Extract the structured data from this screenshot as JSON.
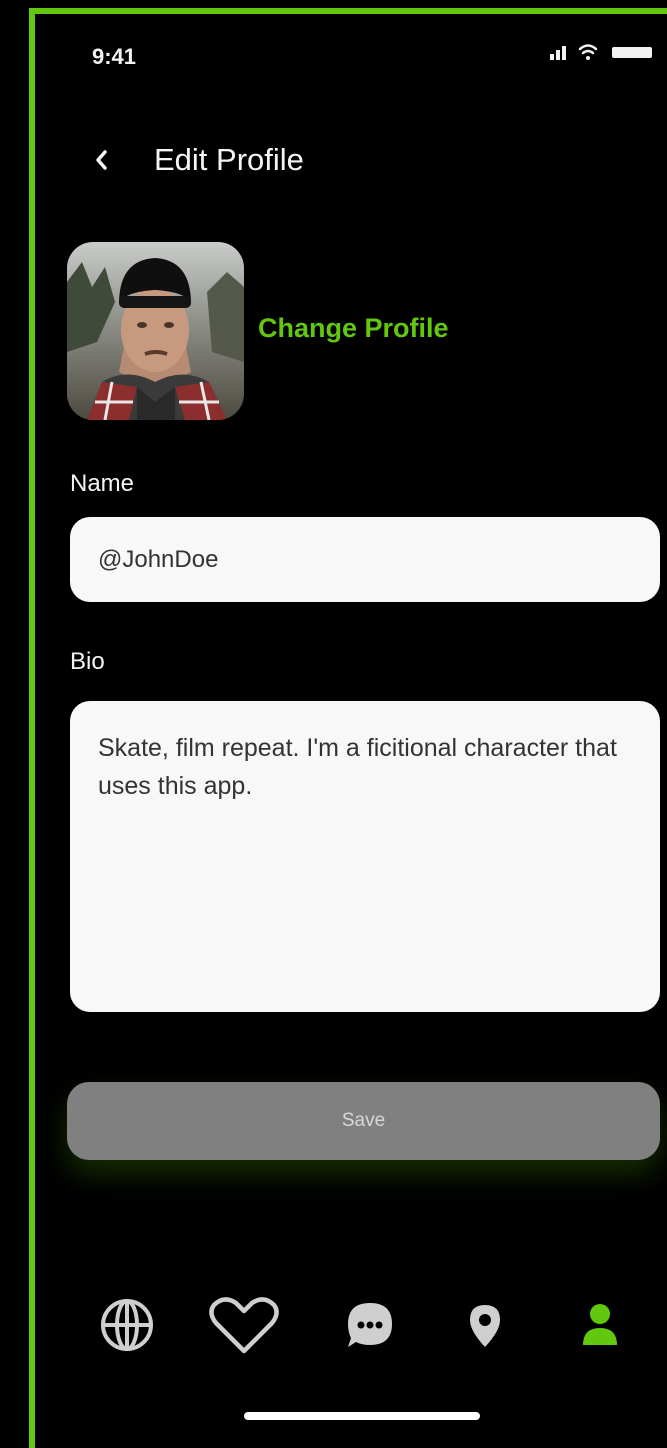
{
  "status_bar": {
    "time": "9:41"
  },
  "header": {
    "title": "Edit Profile"
  },
  "profile": {
    "change_label": "Change Profile"
  },
  "form": {
    "name_label": "Name",
    "name_value": "@JohnDoe",
    "bio_label": "Bio",
    "bio_value": "Skate, film repeat. I'm a ficitional character that uses this app.",
    "save_label": "Save"
  },
  "bottom_nav": {
    "items": [
      {
        "icon": "globe-icon",
        "active": false
      },
      {
        "icon": "heart-icon",
        "active": false
      },
      {
        "icon": "chat-icon",
        "active": false
      },
      {
        "icon": "location-pin-icon",
        "active": false
      },
      {
        "icon": "profile-icon",
        "active": true
      }
    ]
  },
  "colors": {
    "accent": "#62c70f",
    "background": "#000000",
    "inactive_icon": "#cfcfcf",
    "button": "#808080"
  }
}
